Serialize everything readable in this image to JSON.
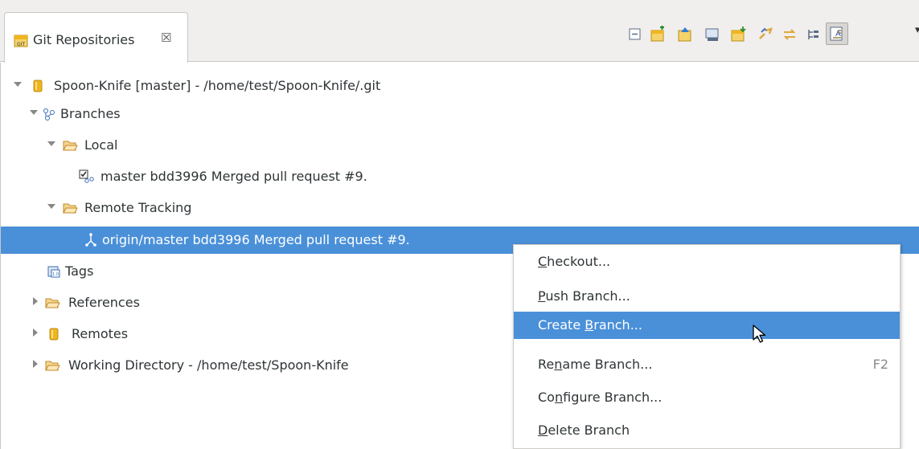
{
  "tab": {
    "title": "Git Repositories",
    "close_glyph": "☒",
    "icon": "git-repository-icon"
  },
  "toolbar": {
    "buttons": [
      "collapse-all-icon",
      "add-repository-icon",
      "clone-repository-icon",
      "create-repository-icon",
      "import-repository-icon",
      "link-with-selection-icon",
      "sync-icon",
      "tree-mode-icon",
      "show-details-icon"
    ],
    "menu_glyph": "▾"
  },
  "tree": {
    "repo": {
      "label": "Spoon-Knife [master] - /home/test/Spoon-Knife/.git"
    },
    "branches": {
      "label": "Branches"
    },
    "local": {
      "label": "Local"
    },
    "local_master": {
      "label": "master bdd3996 Merged pull request #9."
    },
    "remote_tracking": {
      "label": "Remote Tracking"
    },
    "origin_master": {
      "label": "origin/master bdd3996 Merged pull request #9."
    },
    "tags": {
      "label": "Tags"
    },
    "references": {
      "label": "References"
    },
    "remotes": {
      "label": "Remotes"
    },
    "working_dir": {
      "label": "Working Directory - /home/test/Spoon-Knife"
    }
  },
  "context_menu": {
    "items": [
      {
        "pre": "",
        "mn": "C",
        "post": "heckout...",
        "accel": ""
      },
      {
        "pre": "",
        "mn": "P",
        "post": "ush Branch...",
        "accel": ""
      },
      {
        "pre": "Create ",
        "mn": "B",
        "post": "ranch...",
        "accel": ""
      },
      {
        "pre": "Re",
        "mn": "n",
        "post": "ame Branch...",
        "accel": "F2"
      },
      {
        "pre": "Co",
        "mn": "n",
        "post": "figure Branch...",
        "accel": ""
      },
      {
        "pre": "",
        "mn": "D",
        "post": "elete Branch",
        "accel": ""
      }
    ],
    "hovered_index": 2
  },
  "colors": {
    "selection": "#4a90d9",
    "folder": "#e0a63a",
    "repo": "#f1b51c"
  }
}
